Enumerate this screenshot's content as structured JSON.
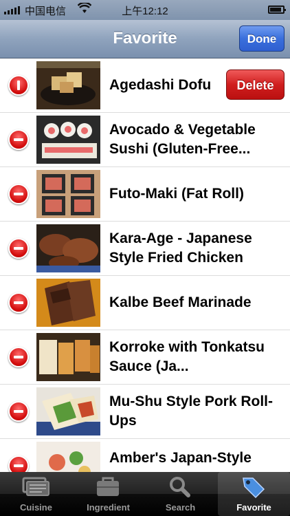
{
  "status_bar": {
    "carrier": "中国电信",
    "time": "上午12:12"
  },
  "nav": {
    "title": "Favorite",
    "done_label": "Done"
  },
  "rows": [
    {
      "name": "Agedashi Dofu",
      "state": "delete-confirm",
      "delete_label": "Delete"
    },
    {
      "name": "Avocado & Vegetable Sushi (Gluten-Free..."
    },
    {
      "name": "Futo-Maki (Fat Roll)"
    },
    {
      "name": "Kara-Age - Japanese Style Fried Chicken"
    },
    {
      "name": "Kalbe Beef Marinade"
    },
    {
      "name": "Korroke with Tonkatsu Sauce (Ja..."
    },
    {
      "name": "Mu-Shu Style Pork Roll-Ups"
    },
    {
      "name": "Amber's Japan-Style"
    }
  ],
  "tabs": [
    {
      "label": "Cuisine",
      "icon": "cuisine-icon",
      "selected": false
    },
    {
      "label": "Ingredient",
      "icon": "bag-icon",
      "selected": false
    },
    {
      "label": "Search",
      "icon": "search-icon",
      "selected": false
    },
    {
      "label": "Favorite",
      "icon": "tag-icon",
      "selected": true
    }
  ],
  "colors": {
    "nav": "#8fa3bd",
    "done": "#3a6fdc",
    "delete": "#d01e1e",
    "tab_selected": "#4a8fe0"
  }
}
